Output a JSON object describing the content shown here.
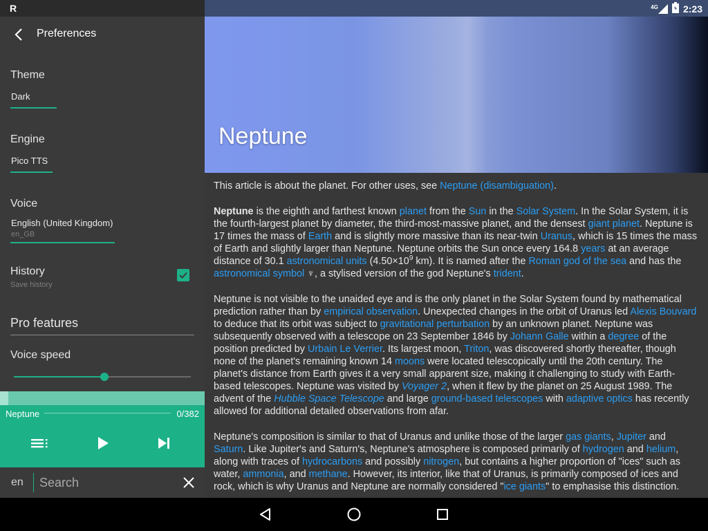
{
  "status": {
    "left_indicator": "R",
    "network": "4G",
    "time": "2:23"
  },
  "drawer": {
    "title": "Preferences",
    "theme": {
      "label": "Theme",
      "value": "Dark"
    },
    "engine": {
      "label": "Engine",
      "value": "Pico TTS"
    },
    "voice": {
      "label": "Voice",
      "value": "English (United Kingdom)",
      "code": "en_GB"
    },
    "history": {
      "label": "History",
      "sub": "Save history",
      "checked": true
    },
    "pro_features": "Pro features",
    "voice_speed": {
      "label": "Voice speed",
      "level": 0.51
    }
  },
  "player": {
    "track": "Neptune",
    "position": "0/382",
    "progress": 0.03
  },
  "search": {
    "lang": "en",
    "placeholder": "Search"
  },
  "article": {
    "title": "Neptune",
    "p0": {
      "t1": "This article is about the planet. For other uses, see ",
      "l1": "Neptune (disambiguation)",
      "t2": "."
    },
    "p1": {
      "b1": "Neptune",
      "t1": " is the eighth and farthest known ",
      "l1": "planet",
      "t2": " from the ",
      "l2": "Sun",
      "t3": " in the ",
      "l3": "Solar System",
      "t4": ". In the Solar System, it is the fourth-largest planet by diameter, the third-most-massive planet, and the densest ",
      "l4": "giant planet",
      "t5": ". Neptune is 17 times the mass of ",
      "l5": "Earth",
      "t6": " and is slightly more massive than its near-twin ",
      "l6": "Uranus",
      "t7": ", which is 15 times the mass of Earth and slightly larger than Neptune. Neptune orbits the Sun once every 164.8 ",
      "l7": "years",
      "t8": " at an average distance of 30.1 ",
      "l8": "astronomical units",
      "t9": " (4.50×10",
      "sup": "9",
      "t10": " km). It is named after the ",
      "l9": "Roman god of the sea",
      "t11": " and has the ",
      "l10": "astronomical symbol",
      "t12": " ♆, a stylised version of the god Neptune's ",
      "l11": "trident",
      "t13": "."
    },
    "p2": {
      "t1": "Neptune is not visible to the unaided eye and is the only planet in the Solar System found by mathematical prediction rather than by ",
      "l1": "empirical observation",
      "t2": ". Unexpected changes in the orbit of Uranus led ",
      "l2": "Alexis Bouvard",
      "t3": " to deduce that its orbit was subject to ",
      "l3": "gravitational perturbation",
      "t4": " by an unknown planet. Neptune was subsequently observed with a telescope on 23 September 1846 by ",
      "l4": "Johann Galle",
      "t5": " within a ",
      "l5": "degree",
      "t6": " of the position predicted by ",
      "l6": "Urbain Le Verrier",
      "t7": ". Its largest moon, ",
      "l7": "Triton",
      "t8": ", was discovered shortly thereafter, though none of the planet's remaining known 14 ",
      "l8": "moons",
      "t9": " were located telescopically until the 20th century. The planet's distance from Earth gives it a very small apparent size, making it challenging to study with Earth-based telescopes. Neptune was visited by ",
      "l9": "Voyager 2",
      "t10": ", when it flew by the planet on 25 August 1989. The advent of the ",
      "l10": "Hubble Space Telescope",
      "t11": " and large ",
      "l11": "ground-based telescopes",
      "t12": " with ",
      "l12": "adaptive optics",
      "t13": " has recently allowed for additional detailed observations from afar."
    },
    "p3": {
      "t1": "Neptune's composition is similar to that of Uranus and unlike those of the larger ",
      "l1": "gas giants",
      "t2": ", ",
      "l2": "Jupiter",
      "t3": " and ",
      "l3": "Saturn",
      "t4": ". Like Jupiter's and Saturn's, Neptune's atmosphere is composed primarily of ",
      "l4": "hydrogen",
      "t5": " and ",
      "l5": "helium",
      "t6": ", along with traces of ",
      "l6": "hydrocarbons",
      "t7": " and possibly ",
      "l7": "nitrogen",
      "t8": ", but contains a higher proportion of \"ices\" such as water, ",
      "l8": "ammonia",
      "t9": ", and ",
      "l9": "methane",
      "t10": ". However, its interior, like that of Uranus, is primarily composed of ices and rock, which is why Uranus and Neptune are normally considered \"",
      "l10": "ice giants",
      "t11": "\" to emphasise this distinction."
    }
  },
  "colors": {
    "accent": "#1db188",
    "link": "#2b9df4",
    "drawer_bg": "#3a3a3a",
    "article_bg": "#383838"
  },
  "icons": {
    "back": "arrow-back-icon",
    "check": "check-icon",
    "playlist": "playlist-icon",
    "play": "play-icon",
    "skip": "skip-next-icon",
    "clear": "close-icon",
    "nav_back": "triangle-back-icon",
    "nav_home": "circle-home-icon",
    "nav_recents": "square-recents-icon"
  }
}
